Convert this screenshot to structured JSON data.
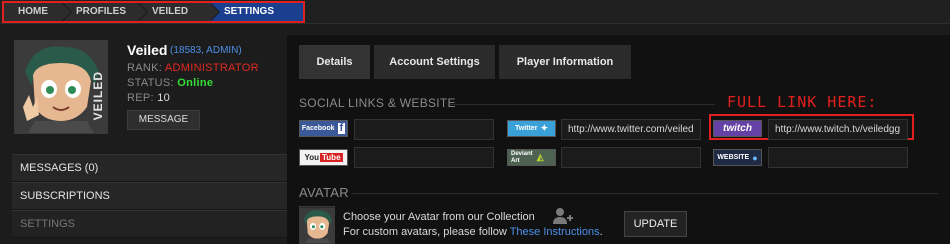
{
  "breadcrumb": [
    "HOME",
    "PROFILES",
    "VEILED",
    "SETTINGS"
  ],
  "profile": {
    "name": "Veiled",
    "meta_open": "(",
    "user_id": "18583",
    "meta_sep": ", ",
    "role_link": "ADMIN",
    "meta_close": ")",
    "rank_label": "RANK:",
    "rank_value": "ADMINISTRATOR",
    "status_label": "STATUS:",
    "status_value": "Online",
    "rep_label": "REP:",
    "rep_value": "10",
    "avatar_tag": "VEILED",
    "message_button": "MESSAGE",
    "colors": {
      "rank": "#e22a22",
      "status": "#33dd33",
      "link": "#4d8fe8"
    }
  },
  "sidebar": {
    "items": [
      {
        "label": "MESSAGES (0)"
      },
      {
        "label": "SUBSCRIPTIONS"
      },
      {
        "label": "SETTINGS"
      }
    ]
  },
  "tabs": [
    {
      "label": "Details",
      "active": true
    },
    {
      "label": "Account Settings",
      "active": false
    },
    {
      "label": "Player Information",
      "active": false
    }
  ],
  "social": {
    "title": "SOCIAL LINKS & WEBSITE",
    "annotation": "FULL LINK HERE:",
    "links": {
      "facebook": {
        "logo": "Facebook",
        "value": ""
      },
      "twitter": {
        "logo": "Twitter",
        "value": "http://www.twitter.com/veiled"
      },
      "twitch": {
        "logo": "twitch",
        "value": "http://www.twitch.tv/veiledgg"
      },
      "youtube": {
        "logo_you": "You",
        "logo_tube": "Tube",
        "value": ""
      },
      "deviantart": {
        "logo_top": "Deviant",
        "logo_bottom": "Art",
        "value": ""
      },
      "website": {
        "logo": "WEBSITE",
        "value": ""
      }
    }
  },
  "avatar": {
    "title": "AVATAR",
    "line1": "Choose your Avatar from our Collection",
    "line2_prefix": "For custom avatars, please follow ",
    "line2_link": "These Instructions",
    "line2_suffix": ".",
    "update_button": "UPDATE"
  },
  "icons": {
    "facebook": "facebook-icon",
    "twitter": "twitter-bird-icon",
    "website": "globe-icon",
    "add_user": "add-user-icon"
  }
}
